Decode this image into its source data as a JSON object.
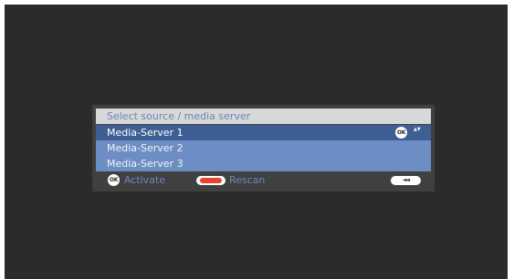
{
  "dialog": {
    "title": "Select source / media server",
    "items": [
      {
        "label": "Media-Server 1",
        "selected": true
      },
      {
        "label": "Media-Server 2",
        "selected": false
      },
      {
        "label": "Media-Server 3",
        "selected": false
      }
    ],
    "selected_hint": {
      "button": "OK",
      "arrows": "▲▼"
    }
  },
  "footer": {
    "ok_button": "OK",
    "activate_label": "Activate",
    "rescan_label": "Rescan",
    "back_symbol": "◄◄"
  },
  "colors": {
    "background": "#2d2b2a",
    "dialog": "#404040",
    "title_bar": "#d8d8d8",
    "accent_text": "#6b87b8",
    "item": "#6d8ec4",
    "item_selected": "#3d5f94",
    "red_key": "#e8432f"
  },
  "icons": {
    "ok": "ok-button-icon",
    "updown": "up-down-arrows-icon",
    "red": "red-key-icon",
    "back": "back-key-icon"
  }
}
